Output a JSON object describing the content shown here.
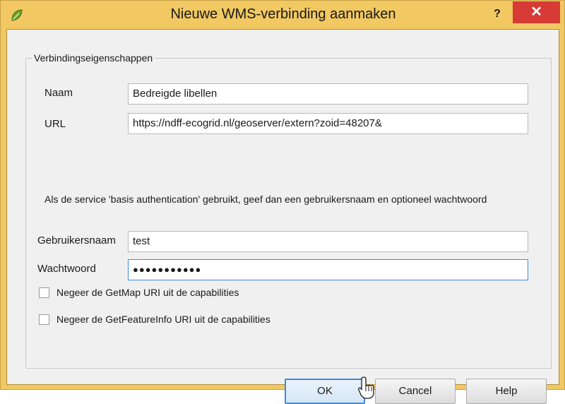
{
  "window": {
    "title": "Nieuwe WMS-verbinding aanmaken",
    "help_label": "?",
    "close_label": "✕",
    "app_icon": "qgis-icon"
  },
  "group": {
    "title": "Verbindingseigenschappen"
  },
  "fields": {
    "name_label": "Naam",
    "name_value": "Bedreigde libellen",
    "url_label": "URL",
    "url_value": "https://ndff-ecogrid.nl/geoserver/extern?zoid=48207&",
    "username_label": "Gebruikersnaam",
    "username_value": "test",
    "password_label": "Wachtwoord",
    "password_value": "●●●●●●●●●●●"
  },
  "info_text": "Als de service 'basis authentication' gebruikt, geef dan een gebruikersnaam en optioneel wachtwoord",
  "options": {
    "ignore_getmap_label": "Negeer de GetMap URI uit de capabilities",
    "ignore_getmap_checked": false,
    "ignore_getfeatureinfo_label": "Negeer de GetFeatureInfo URI uit de capabilities",
    "ignore_getfeatureinfo_checked": false
  },
  "buttons": {
    "ok_label": "OK",
    "cancel_label": "Cancel",
    "help_label": "Help"
  },
  "colors": {
    "titlebar": "#f1c862",
    "close": "#d83a35",
    "focus": "#3d8be0"
  }
}
